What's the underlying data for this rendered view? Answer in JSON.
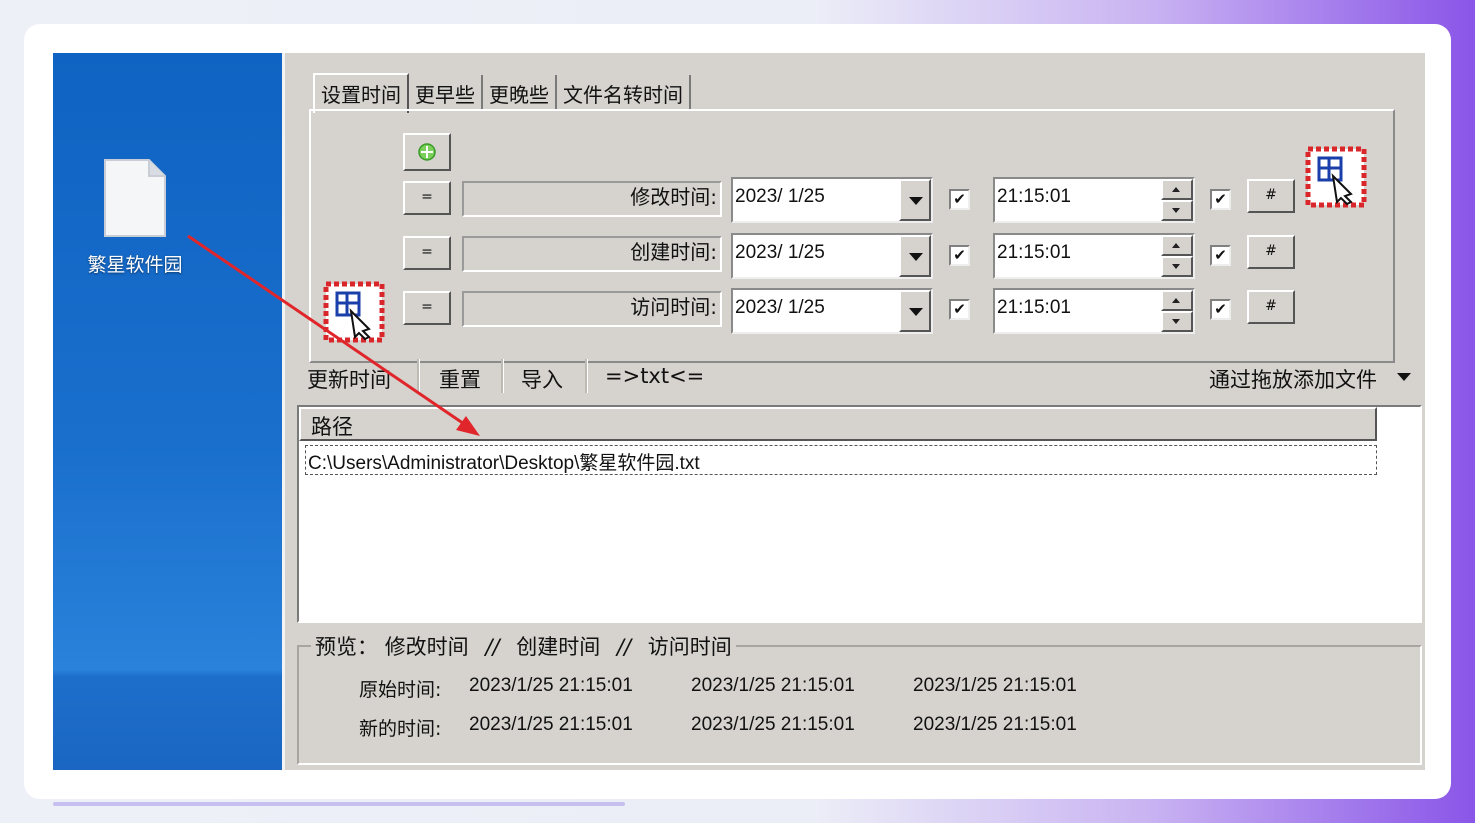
{
  "desktop": {
    "file_label": "繁星软件园"
  },
  "tabs": [
    "设置时间",
    "更早些",
    "更晚些",
    "文件名转时间"
  ],
  "rows": [
    {
      "button": "=",
      "label": "修改时间:",
      "date": "2023/ 1/25",
      "date_checked": true,
      "time": "21:15:01",
      "time_checked": true,
      "hash": "#"
    },
    {
      "button": "=",
      "label": "创建时间:",
      "date": "2023/ 1/25",
      "date_checked": true,
      "time": "21:15:01",
      "time_checked": true,
      "hash": "#"
    },
    {
      "button": "=",
      "label": "访问时间:",
      "date": "2023/ 1/25",
      "date_checked": true,
      "time": "21:15:01",
      "time_checked": true,
      "hash": "#"
    }
  ],
  "toolbar": {
    "update": "更新时间",
    "reset": "重置",
    "import": "导入",
    "txt": "=>txt<=",
    "drag_add": "通过拖放添加文件"
  },
  "list": {
    "header": "路径",
    "rows": [
      "C:\\Users\\Administrator\\Desktop\\繁星软件园.txt"
    ]
  },
  "preview": {
    "legend_prefix": "预览：",
    "col1": "修改时间",
    "sep1": "//",
    "col2": "创建时间",
    "sep2": "//",
    "col3": "访问时间",
    "original_label": "原始时间:",
    "original": [
      "2023/1/25 21:15:01",
      "2023/1/25 21:15:01",
      "2023/1/25 21:15:01"
    ],
    "new_label": "新的时间:",
    "new": [
      "2023/1/25 21:15:01",
      "2023/1/25 21:15:01",
      "2023/1/25 21:15:01"
    ]
  },
  "colors": {
    "arrow": "#e0262b",
    "desktop": "#1a6fcd",
    "dialog": "#d6d3ce"
  }
}
